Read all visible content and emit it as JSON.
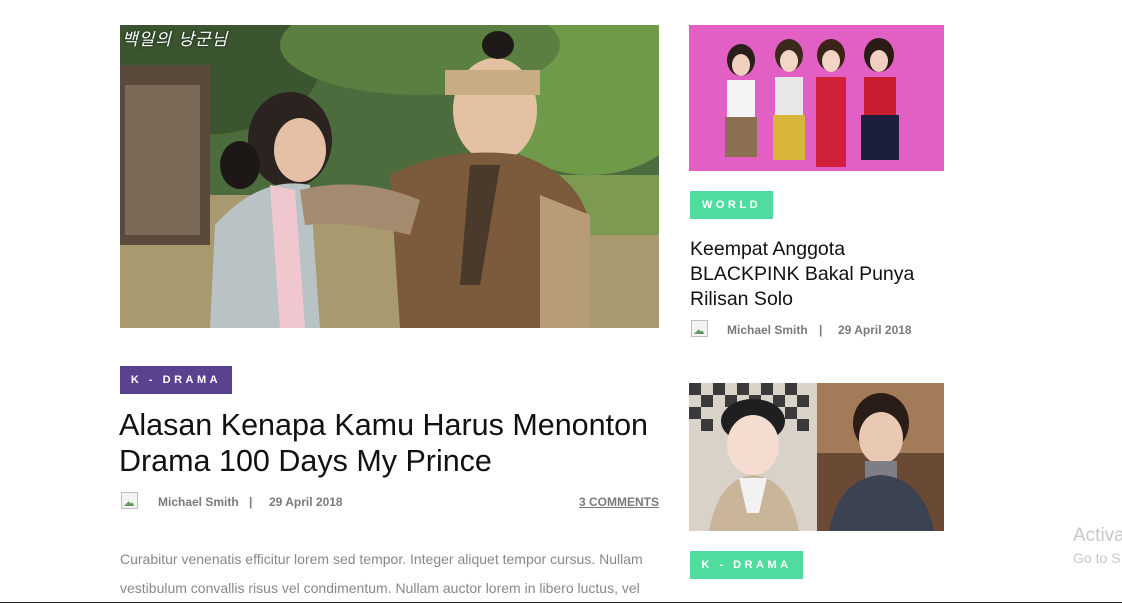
{
  "main_article": {
    "image_overlay_text": "백일의 낭군님",
    "category": "K - DRAMA",
    "title": "Alasan Kenapa Kamu Harus Menonton Drama 100 Days My Prince",
    "author": "Michael Smith",
    "separator": "|",
    "date": "29 April 2018",
    "comments": "3 COMMENTS",
    "excerpt": "Curabitur venenatis efficitur lorem sed tempor. Integer aliquet tempor cursus. Nullam vestibulum convallis risus vel condimentum. Nullam auctor lorem in libero luctus, vel"
  },
  "sidebar": {
    "post1": {
      "category": "WORLD",
      "title": "Keempat Anggota BLACKPINK Bakal Punya Rilisan Solo",
      "author": "Michael Smith",
      "separator": "|",
      "date": "29 April 2018"
    },
    "post2": {
      "category": "K - DRAMA"
    }
  },
  "watermark": {
    "line1": "Activa",
    "line2": "Go to S"
  },
  "colors": {
    "kdrama_badge": "#5d4191",
    "world_badge": "#4fdc9e"
  }
}
